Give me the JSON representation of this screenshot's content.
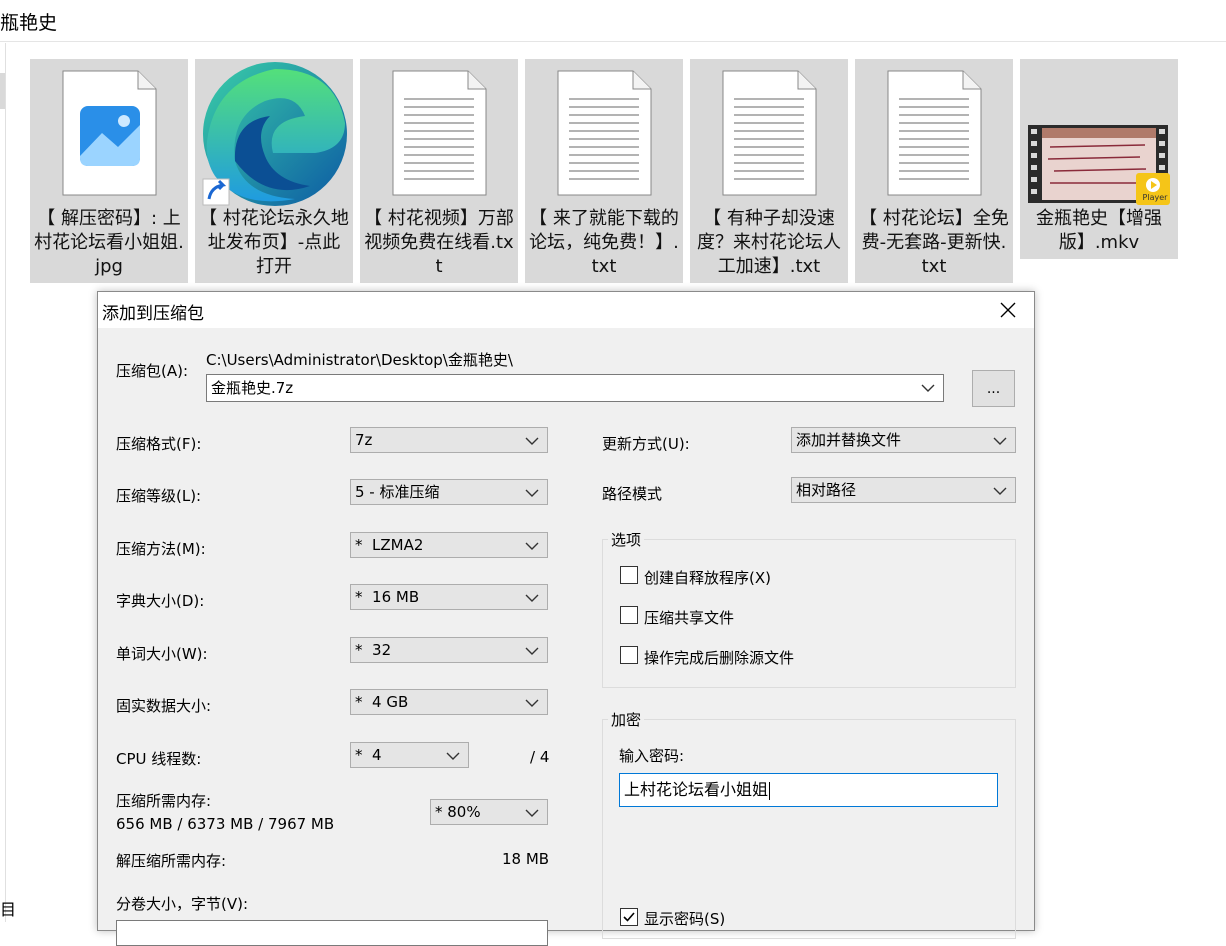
{
  "explorer": {
    "folder_title": "瓶艳史",
    "left_label": "目",
    "files": [
      {
        "name": "【 解压密码】: 上村花论坛看小姐姐.jpg",
        "icon": "image-file-icon"
      },
      {
        "name": "【 村花论坛永久地址发布页】-点此打开",
        "icon": "edge-shortcut-icon"
      },
      {
        "name": "【 村花视频】万部视频免费在线看.txt",
        "icon": "text-file-icon"
      },
      {
        "name": "【 来了就能下载的论坛，纯免费！】.txt",
        "icon": "text-file-icon"
      },
      {
        "name": "【 有种子却没速度？来村花论坛人工加速】.txt",
        "icon": "text-file-icon"
      },
      {
        "name": "【 村花论坛】全免费-无套路-更新快.txt",
        "icon": "text-file-icon"
      },
      {
        "name": "金瓶艳史【增强版】.mkv",
        "icon": "video-file-icon",
        "badge": "Player"
      }
    ]
  },
  "dialog": {
    "title": "添加到压缩包",
    "close_icon": "close-icon",
    "archive_label": "压缩包(A):",
    "archive_path": "C:\\Users\\Administrator\\Desktop\\金瓶艳史\\",
    "archive_name": "金瓶艳史.7z",
    "browse_label": "...",
    "format_label": "压缩格式(F):",
    "format_value": "7z",
    "level_label": "压缩等级(L):",
    "level_value": "5 - 标准压缩",
    "method_label": "压缩方法(M):",
    "method_value": "*  LZMA2",
    "dict_label": "字典大小(D):",
    "dict_value": "*  16 MB",
    "word_label": "单词大小(W):",
    "word_value": "*  32",
    "solid_label": "固实数据大小:",
    "solid_value": "*  4 GB",
    "threads_label": "CPU 线程数:",
    "threads_value": "*  4",
    "threads_total": "/ 4",
    "mem_comp_label": "压缩所需内存:",
    "mem_comp_value": "656 MB / 6373 MB / 7967 MB",
    "mem_percent": "* 80%",
    "mem_decomp_label": "解压缩所需内存:",
    "mem_decomp_value": "18 MB",
    "volume_label": "分卷大小，字节(V):",
    "update_label": "更新方式(U):",
    "update_value": "添加并替换文件",
    "path_label": "路径模式",
    "path_value": "相对路径",
    "options_title": "选项",
    "opt_sfx": "创建自释放程序(X)",
    "opt_shared": "压缩共享文件",
    "opt_delete": "操作完成后删除源文件",
    "encrypt_title": "加密",
    "password_label": "输入密码:",
    "password_value": "上村花论坛看小姐姐",
    "show_password": "显示密码(S)"
  }
}
